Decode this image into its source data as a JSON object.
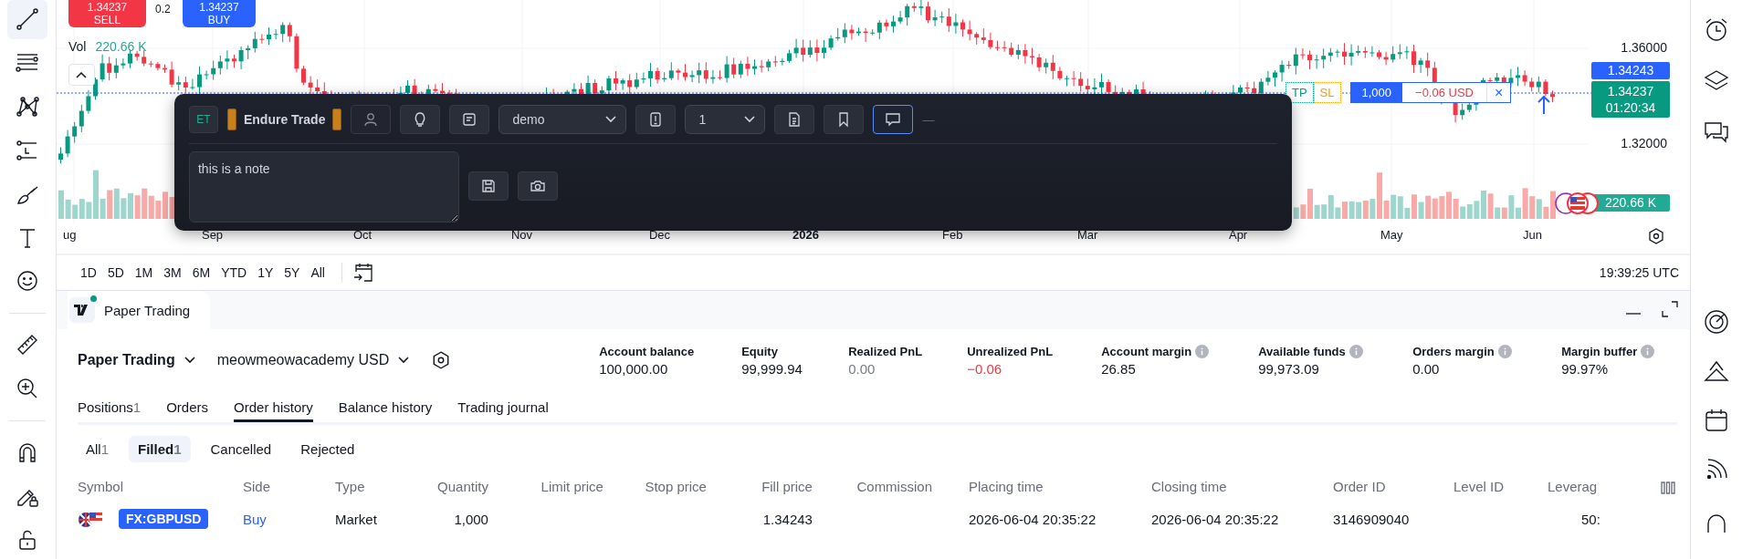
{
  "left_toolbar": {
    "tools": [
      {
        "kind": "trendline",
        "selected": true
      },
      {
        "kind": "fib",
        "selected": false
      },
      {
        "kind": "pattern",
        "selected": false
      },
      {
        "kind": "projection",
        "selected": false
      },
      {
        "kind": "brush",
        "selected": false
      },
      {
        "kind": "text",
        "selected": false
      },
      {
        "kind": "emoji",
        "selected": false
      },
      {
        "kind": "ruler",
        "selected": false
      },
      {
        "kind": "zoom",
        "selected": false
      },
      {
        "kind": "magnet",
        "selected": false
      },
      {
        "kind": "drawlock",
        "selected": false
      },
      {
        "kind": "lock",
        "selected": false
      }
    ]
  },
  "chart": {
    "sell": {
      "price": "1.34237",
      "label": "SELL"
    },
    "spread": "0.2",
    "buy": {
      "price": "1.34237",
      "label": "BUY"
    },
    "volume": {
      "label": "Vol",
      "value": "220.66 K"
    },
    "price_ticks": [
      "1.36000",
      "1.32000"
    ],
    "bid_tag": "1.34243",
    "last_tag": {
      "price": "1.34237",
      "countdown": "01:20:34"
    },
    "volume_tag": "220.66 K",
    "position": {
      "tp": "TP",
      "sl": "SL",
      "quantity": "1,000",
      "pnl": "−0.06 USD",
      "close": "×"
    },
    "time_labels": [
      {
        "text": "ug",
        "bold": false
      },
      {
        "text": "Sep",
        "bold": false
      },
      {
        "text": "Oct",
        "bold": false
      },
      {
        "text": "Nov",
        "bold": false
      },
      {
        "text": "Dec",
        "bold": false
      },
      {
        "text": "2026",
        "bold": true
      },
      {
        "text": "Feb",
        "bold": false
      },
      {
        "text": "Mar",
        "bold": false
      },
      {
        "text": "Apr",
        "bold": false
      },
      {
        "text": "May",
        "bold": false
      },
      {
        "text": "Jun",
        "bold": false
      }
    ]
  },
  "range_bar": {
    "ranges": [
      "1D",
      "5D",
      "1M",
      "3M",
      "6M",
      "YTD",
      "1Y",
      "5Y",
      "All"
    ],
    "clock": "19:39:25 UTC"
  },
  "popup": {
    "logo": "ET",
    "name": "Endure Trade",
    "note": "this is a note",
    "toolbar": [
      {
        "kind": "button",
        "selected": false
      },
      {
        "kind": "button",
        "selected": false
      },
      {
        "kind": "button",
        "selected": false
      },
      {
        "kind": "select",
        "value": "demo"
      },
      {
        "kind": "button",
        "selected": false
      },
      {
        "kind": "select",
        "value": "1"
      },
      {
        "kind": "button",
        "selected": false
      },
      {
        "kind": "button",
        "selected": false
      },
      {
        "kind": "button",
        "selected": true
      },
      {
        "kind": "text",
        "text": "—"
      }
    ]
  },
  "panel": {
    "title": "Paper Trading",
    "account": {
      "broker": "Paper Trading",
      "name": "meowmeowacademy USD"
    },
    "stats": [
      {
        "label": "Account balance",
        "value": "100,000.00",
        "info": false,
        "kind": "plain"
      },
      {
        "label": "Equity",
        "value": "99,999.94",
        "info": false,
        "kind": "plain"
      },
      {
        "label": "Realized PnL",
        "value": "0.00",
        "info": false,
        "kind": "muted"
      },
      {
        "label": "Unrealized PnL",
        "value": "−0.06",
        "info": false,
        "kind": "negative"
      },
      {
        "label": "Account margin",
        "value": "26.85",
        "info": true,
        "kind": "plain"
      },
      {
        "label": "Available funds",
        "value": "99,973.09",
        "info": true,
        "kind": "plain"
      },
      {
        "label": "Orders margin",
        "value": "0.00",
        "info": true,
        "kind": "plain"
      },
      {
        "label": "Margin buffer",
        "value": "99.97%",
        "info": true,
        "kind": "plain"
      }
    ],
    "tabs": [
      {
        "label": "Positions",
        "count": "1",
        "selected": false
      },
      {
        "label": "Orders",
        "selected": false
      },
      {
        "label": "Order history",
        "selected": true
      },
      {
        "label": "Balance history",
        "selected": false
      },
      {
        "label": "Trading journal",
        "selected": false
      }
    ],
    "filters": [
      {
        "label": "All",
        "count": "1",
        "selected": false
      },
      {
        "label": "Filled",
        "count": "1",
        "selected": true
      },
      {
        "label": "Cancelled",
        "selected": false
      },
      {
        "label": "Rejected",
        "selected": false
      }
    ],
    "columns": [
      "Symbol",
      "Side",
      "Type",
      "Quantity",
      "Limit price",
      "Stop price",
      "Fill price",
      "Commission",
      "Placing time",
      "Closing time",
      "Order ID",
      "Level ID",
      "Leverag"
    ],
    "rows": [
      {
        "symbol": "FX:GBPUSD",
        "side": "Buy",
        "type": "Market",
        "quantity": "1,000",
        "fill_price": "1.34243",
        "placing_time": "2026-06-04 20:35:22",
        "closing_time": "2026-06-04 20:35:22",
        "order_id": "3146909040",
        "leverage": "50:"
      }
    ]
  }
}
